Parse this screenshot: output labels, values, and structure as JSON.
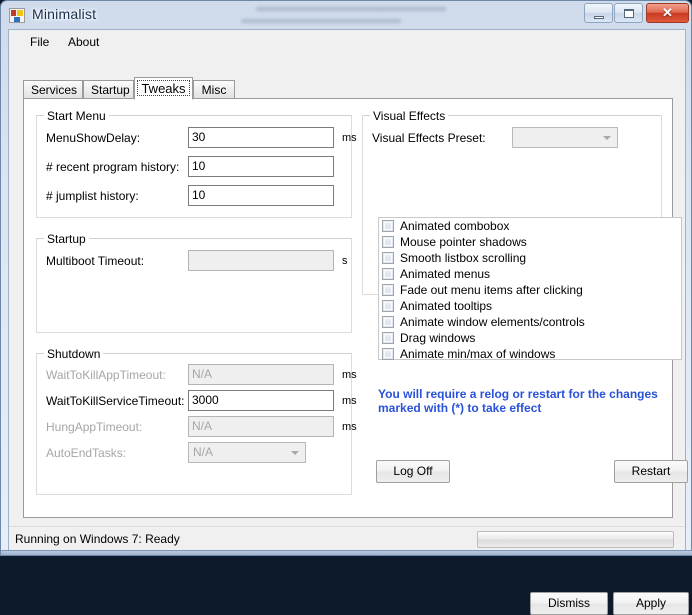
{
  "window": {
    "title": "Minimalist",
    "icon": "app-window-icon",
    "controls": {
      "minimize": "minimize-icon",
      "maximize": "maximize-icon",
      "close_glyph": "✕"
    }
  },
  "menubar": {
    "items": [
      {
        "label": "File"
      },
      {
        "label": "About"
      }
    ]
  },
  "tabs": [
    {
      "label": "Services",
      "selected": false
    },
    {
      "label": "Startup",
      "selected": false
    },
    {
      "label": "Tweaks",
      "selected": true
    },
    {
      "label": "Misc",
      "selected": false
    }
  ],
  "start_menu_group": {
    "legend": "Start Menu",
    "fields": [
      {
        "label": "MenuShowDelay:",
        "value": "30",
        "unit": "ms",
        "disabled": false
      },
      {
        "label": "# recent program history:",
        "value": "10",
        "unit": "",
        "disabled": false
      },
      {
        "label": "# jumplist history:",
        "value": "10",
        "unit": "",
        "disabled": false
      }
    ]
  },
  "startup_group": {
    "legend": "Startup",
    "fields": [
      {
        "label": "Multiboot Timeout:",
        "value": "",
        "unit": "s",
        "disabled": true
      }
    ]
  },
  "shutdown_group": {
    "legend": "Shutdown",
    "fields": [
      {
        "label": "WaitToKillAppTimeout:",
        "value": "N/A",
        "unit": "ms",
        "disabled": true,
        "type": "textbox"
      },
      {
        "label": "WaitToKillServiceTimeout:",
        "value": "3000",
        "unit": "ms",
        "disabled": false,
        "type": "textbox"
      },
      {
        "label": "HungAppTimeout:",
        "value": "N/A",
        "unit": "ms",
        "disabled": true,
        "type": "textbox"
      },
      {
        "label": "AutoEndTasks:",
        "value": "N/A",
        "unit": "",
        "disabled": true,
        "type": "combobox"
      }
    ]
  },
  "visual_effects_group": {
    "legend": "Visual Effects",
    "preset_label": "Visual Effects Preset:",
    "preset_value": "",
    "effects": [
      {
        "label": "Animated combobox",
        "checked": false
      },
      {
        "label": "Mouse pointer shadows",
        "checked": false
      },
      {
        "label": "Smooth listbox scrolling",
        "checked": false
      },
      {
        "label": "Animated menus",
        "checked": false
      },
      {
        "label": "Fade out menu items after clicking",
        "checked": false
      },
      {
        "label": "Animated tooltips",
        "checked": false
      },
      {
        "label": "Animate window elements/controls",
        "checked": false
      },
      {
        "label": "Drag windows",
        "checked": false
      },
      {
        "label": "Animate min/max of windows",
        "checked": false
      }
    ]
  },
  "warning": {
    "line1": "You will require a relog or restart for the changes",
    "line2": "marked with (*) to take effect",
    "color": "#2a52d8"
  },
  "buttons": {
    "log_off": "Log Off",
    "restart": "Restart",
    "dismiss": "Dismiss",
    "apply": "Apply"
  },
  "statusbar": {
    "text": "Running on Windows 7: Ready",
    "progress_percent": 0
  }
}
